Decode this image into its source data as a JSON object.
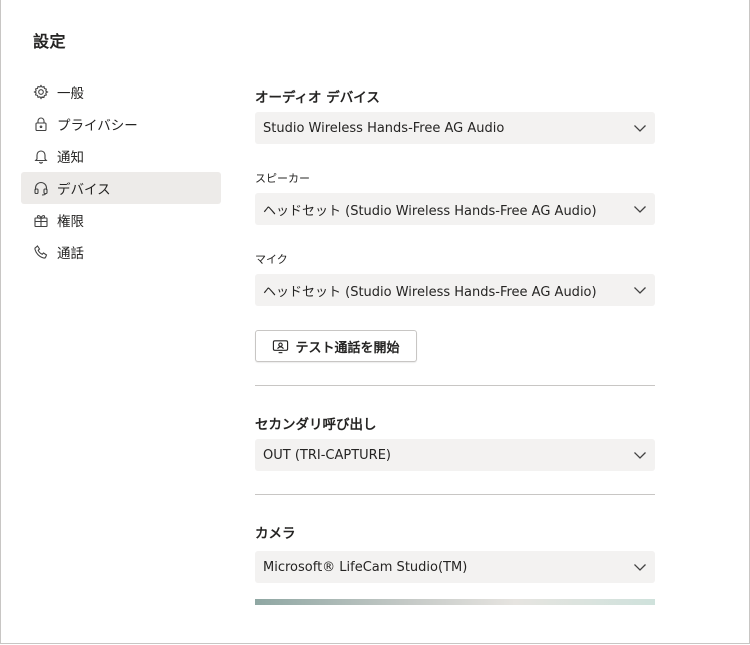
{
  "window": {
    "title": "設定"
  },
  "nav": {
    "items": [
      {
        "label": "一般",
        "icon": "gear-icon"
      },
      {
        "label": "プライバシー",
        "icon": "lock-icon"
      },
      {
        "label": "通知",
        "icon": "bell-icon"
      },
      {
        "label": "デバイス",
        "icon": "headset-icon",
        "selected": true
      },
      {
        "label": "権限",
        "icon": "gift-box-icon"
      },
      {
        "label": "通話",
        "icon": "phone-icon"
      }
    ]
  },
  "devices": {
    "audio_section_title": "オーディオ デバイス",
    "audio_device_value": "Studio Wireless Hands-Free AG Audio",
    "speaker_label": "スピーカー",
    "speaker_value": "ヘッドセット (Studio Wireless Hands-Free AG Audio)",
    "mic_label": "マイク",
    "mic_value": "ヘッドセット (Studio Wireless Hands-Free AG Audio)",
    "test_call_label": "テスト通話を開始",
    "secondary_ring_title": "セカンダリ呼び出し",
    "secondary_ring_value": "OUT (TRI-CAPTURE)",
    "camera_title": "カメラ",
    "camera_value": "Microsoft® LifeCam Studio(TM)"
  }
}
